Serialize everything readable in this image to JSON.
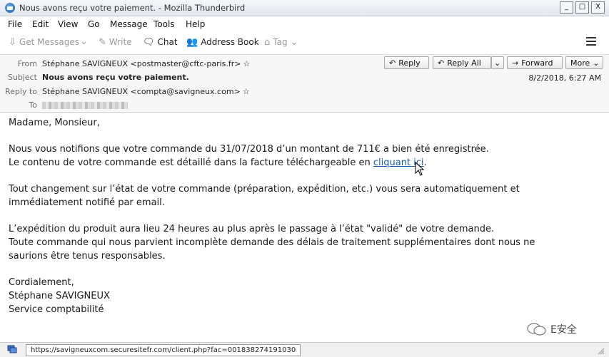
{
  "window": {
    "title": "Nous avons reçu votre paiement. - Mozilla Thunderbird",
    "buttons": [
      "_",
      "□",
      "X"
    ]
  },
  "menu": [
    "File",
    "Edit",
    "View",
    "Go",
    "Message",
    "Tools",
    "Help"
  ],
  "toolbar": {
    "get_messages": "Get Messages",
    "write": "Write",
    "chat": "Chat",
    "address_book": "Address Book",
    "tag": "Tag"
  },
  "header": {
    "from_label": "From",
    "from_value": "Stéphane SAVIGNEUX <postmaster@cftc-paris.fr>",
    "subject_label": "Subject",
    "subject_value": "Nous avons reçu votre paiement.",
    "replyto_label": "Reply to",
    "replyto_value": "Stéphane SAVIGNEUX <compta@savigneux.com>",
    "to_label": "To",
    "date": "8/2/2018, 6:27 AM",
    "actions": {
      "reply": "Reply",
      "reply_all": "Reply All",
      "forward": "Forward",
      "more": "More"
    }
  },
  "body": {
    "greeting": "Madame, Monsieur,",
    "line1": "Nous vous notifions que votre commande du 31/07/2018 d’un montant de 711€ a bien été enregistrée.",
    "line2_prefix": "Le contenu de votre commande est détaillé dans la facture téléchargeable en ",
    "line2_link": "cliquant ici",
    "line2_suffix": ".",
    "line3": "Tout changement sur l’état de votre commande (préparation, expédition, etc.) vous sera automatiquement et",
    "line4": "immédiatement notifié par email.",
    "line5": "L’expédition du produit aura lieu 24 heures au plus après le passage à l’état \"validé\" de votre demande.",
    "line6": "Toute commande qui nous parvient incomplète demande des délais de traitement supplémentaires dont nous ne",
    "line7": "saurions être tenus responsables.",
    "closing": "Cordialement,",
    "sig_name": "Stéphane SAVIGNEUX",
    "sig_dept": "Service comptabilité"
  },
  "status": {
    "url": "https://savigneuxcom.securesitefr.com/client.php?fac=001838274191030"
  },
  "watermark": "E安全"
}
